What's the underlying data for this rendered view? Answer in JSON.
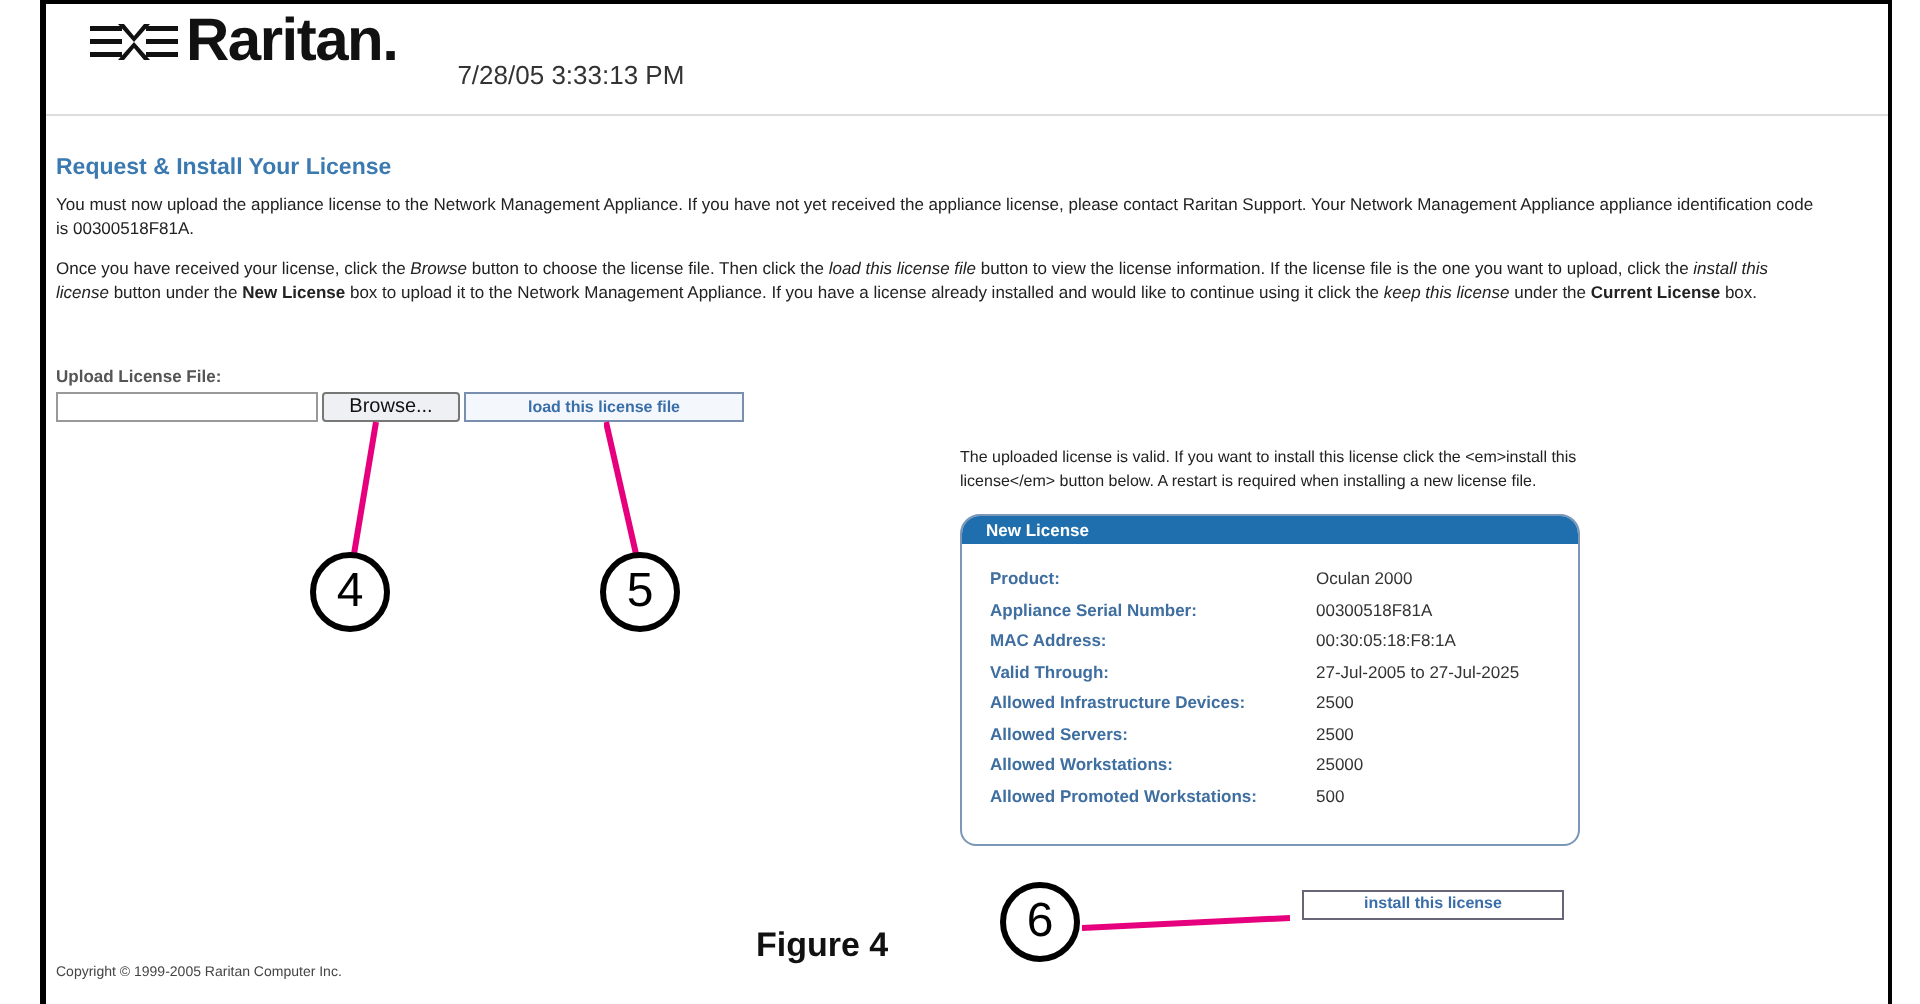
{
  "header": {
    "logo_text": "Raritan.",
    "datetime": "7/28/05 3:33:13 PM"
  },
  "title": "Request & Install Your License",
  "paragraphs": [
    "You must now upload the appliance license to the Network Management Appliance. If you have not yet received the appliance license, please contact Raritan Support. Your Network Management Appliance appliance identification code is 00300518F81A.",
    "Once you have received your license, click the *Browse* button to choose the license file. Then click the *load this license file* button to view the license information. If the license file is the one you want to upload, click the *install this license* button under the **New License** box to upload it to the Network Management Appliance. If you have a license already installed and would like to continue using it click the *keep this license* under the **Current License** box."
  ],
  "upload": {
    "label": "Upload License File:",
    "browse_button": "Browse...",
    "load_button": "load this license file"
  },
  "valid_message": "The uploaded license is valid. If you want to install this license click the <em>install this license</em> button below. A restart is required when installing a new license file.",
  "new_license": {
    "title": "New License",
    "rows": [
      {
        "label": "Product:",
        "value": "Oculan 2000"
      },
      {
        "label": "Appliance Serial Number:",
        "value": "00300518F81A"
      },
      {
        "label": "MAC Address:",
        "value": "00:30:05:18:F8:1A"
      },
      {
        "label": "Valid Through:",
        "value": "27-Jul-2005 to 27-Jul-2025"
      },
      {
        "label": "Allowed Infrastructure Devices:",
        "value": "2500"
      },
      {
        "label": "Allowed Servers:",
        "value": "2500"
      },
      {
        "label": "Allowed Workstations:",
        "value": "25000"
      },
      {
        "label": "Allowed Promoted Workstations:",
        "value": "500"
      }
    ]
  },
  "install_button": "install this license",
  "copyright": "Copyright © 1999-2005 Raritan Computer Inc.",
  "figure_caption": "Figure 4",
  "callouts": [
    "4",
    "5",
    "6"
  ]
}
